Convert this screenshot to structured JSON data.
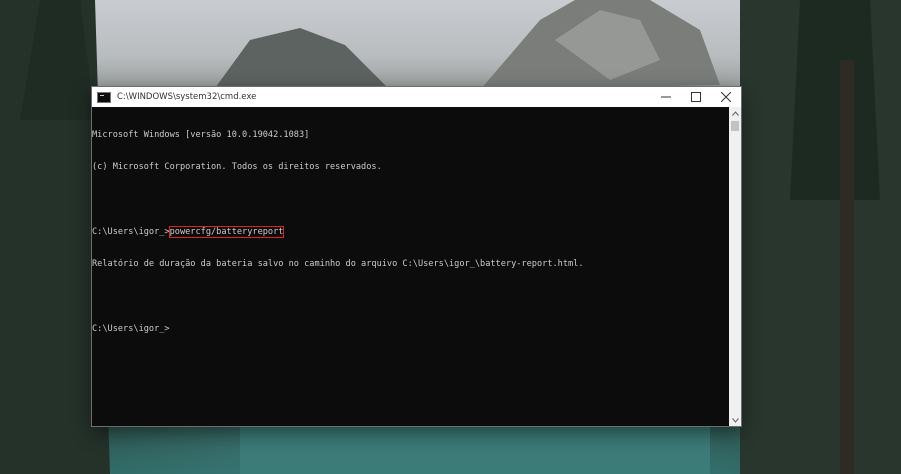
{
  "window": {
    "title": "C:\\WINDOWS\\system32\\cmd.exe",
    "icon": "cmd-icon"
  },
  "console": {
    "line1": "Microsoft Windows [versão 10.0.19042.1083]",
    "line2": "(c) Microsoft Corporation. Todos os direitos reservados.",
    "prompt1": "C:\\Users\\igor_>",
    "command": "powercfg/batteryreport",
    "line4": "Relatório de duração da bateria salvo no caminho do arquivo C:\\Users\\igor_\\battery-report.html.",
    "prompt2": "C:\\Users\\igor_>"
  },
  "colors": {
    "console_bg": "#0c0c0c",
    "console_text": "#cccccc",
    "highlight": "#e02020"
  }
}
